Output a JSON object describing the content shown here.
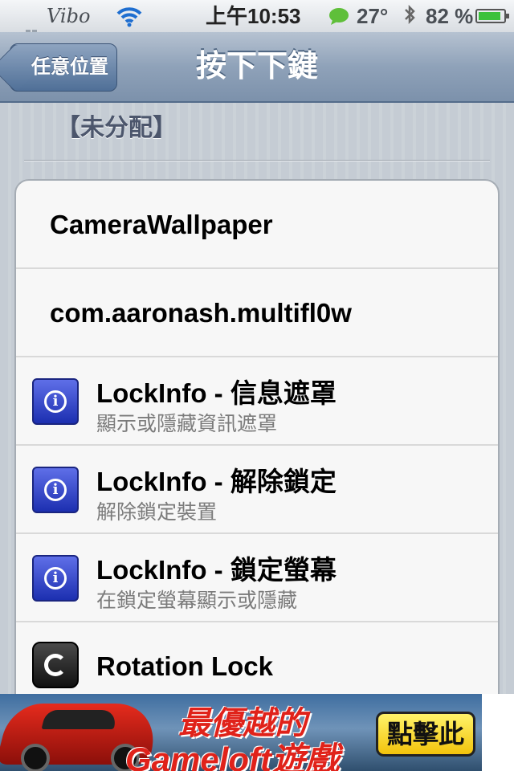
{
  "status_bar": {
    "carrier": "Vibo",
    "time": "上午10:53",
    "temperature": "27°",
    "battery_percent": "82 %",
    "signal_bars": 3,
    "battery_level": 0.82
  },
  "nav": {
    "back_label": "任意位置",
    "title": "按下下鍵"
  },
  "section": {
    "label": "【未分配】"
  },
  "rows": [
    {
      "title": "CameraWallpaper",
      "subtitle": "",
      "icon": ""
    },
    {
      "title": "com.aaronash.multifl0w",
      "subtitle": "",
      "icon": ""
    },
    {
      "title": "LockInfo - 信息遮罩",
      "subtitle": "顯示或隱藏資訊遮罩",
      "icon": "info-icon"
    },
    {
      "title": "LockInfo - 解除鎖定",
      "subtitle": "解除鎖定裝置",
      "icon": "info-icon"
    },
    {
      "title": "LockInfo - 鎖定螢幕",
      "subtitle": "在鎖定螢幕顯示或隱藏",
      "icon": "info-icon"
    },
    {
      "title": "Rotation Lock",
      "subtitle": "",
      "icon": "rotation-icon"
    }
  ],
  "ad": {
    "line1": "最優越的",
    "line2": "Gameloft遊戲",
    "button": "點擊此"
  },
  "colors": {
    "nav_accent": "#7c91ab",
    "info_icon": "#1c2fb0",
    "ad_text": "#e0221a",
    "ad_button": "#f2c30c"
  }
}
